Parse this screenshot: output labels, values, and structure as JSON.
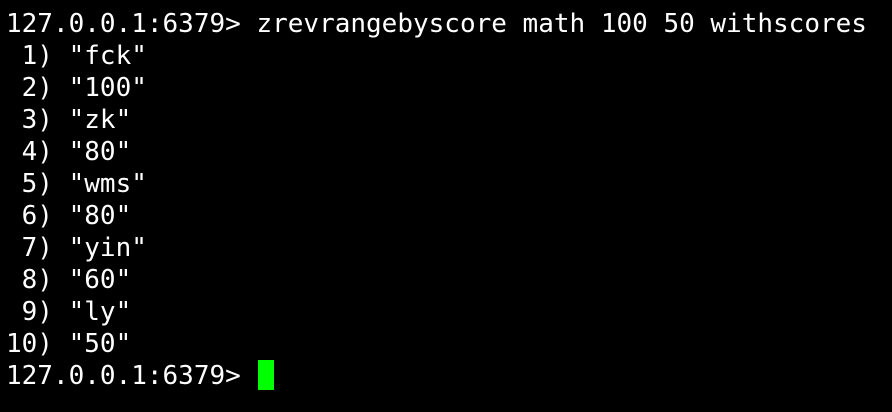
{
  "terminal": {
    "prompt": "127.0.0.1:6379> ",
    "command": "zrevrangebyscore math 100 50 withscores",
    "results": [
      " 1) \"fck\"",
      " 2) \"100\"",
      " 3) \"zk\"",
      " 4) \"80\"",
      " 5) \"wms\"",
      " 6) \"80\"",
      " 7) \"yin\"",
      " 8) \"60\"",
      " 9) \"ly\"",
      "10) \"50\""
    ],
    "cursor_color": "#00ff00"
  }
}
